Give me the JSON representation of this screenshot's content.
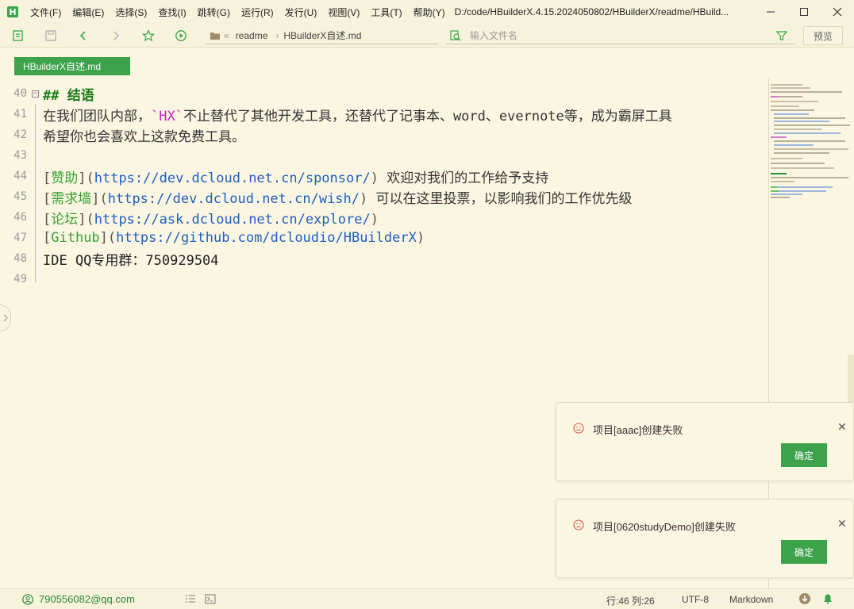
{
  "menubar": {
    "logo": "H",
    "items": [
      "文件(F)",
      "编辑(E)",
      "选择(S)",
      "查找(I)",
      "跳转(G)",
      "运行(R)",
      "发行(U)",
      "视图(V)",
      "工具(T)",
      "帮助(Y)"
    ],
    "path": "D:/code/HBuilderX.4.15.2024050802/HBuilderX/readme/HBuild..."
  },
  "toolbar": {
    "breadcrumb_sep": "«",
    "breadcrumb_folder": "readme",
    "breadcrumb_file": "HBuilderX自述.md",
    "search_placeholder": "输入文件名",
    "preview_label": "预览"
  },
  "tab": {
    "label": "HBuilderX自述.md"
  },
  "editor": {
    "lines": [
      {
        "num": "40"
      },
      {
        "num": "41"
      },
      {
        "num": "42"
      },
      {
        "num": "43"
      },
      {
        "num": "44"
      },
      {
        "num": "45"
      },
      {
        "num": "46"
      },
      {
        "num": "47"
      },
      {
        "num": "48"
      },
      {
        "num": "49"
      }
    ],
    "l40": {
      "hash": "## ",
      "text": "结语"
    },
    "l41": {
      "pre": "在我们团队内部，",
      "code": "`HX`",
      "post": "不止替代了其他开发工具，还替代了记事本、word、evernote等，成为霸屏工具"
    },
    "l42": {
      "text": "希望你也会喜欢上这款免费工具。"
    },
    "l44": {
      "label": "赞助",
      "url": "https://dev.dcloud.net.cn/sponsor/",
      "desc": " 欢迎对我们的工作给予支持"
    },
    "l45": {
      "label": "需求墙",
      "url": "https://dev.dcloud.net.cn/wish/",
      "desc": " 可以在这里投票，以影响我们的工作优先级"
    },
    "l46": {
      "label": "论坛",
      "url": "https://ask.dcloud.net.cn/explore/",
      "desc": ""
    },
    "l47": {
      "label": "Github",
      "url": "https://github.com/dcloudio/HBuilderX",
      "desc": ""
    },
    "l48": {
      "text": "IDE QQ专用群：750929504"
    }
  },
  "notifications": [
    {
      "message": "项目[aaac]创建失败",
      "ok_label": "确定"
    },
    {
      "message": "项目[0620studyDemo]创建失败",
      "ok_label": "确定"
    }
  ],
  "statusbar": {
    "user": "790556082@qq.com",
    "position": "行:46  列:26",
    "encoding": "UTF-8",
    "language": "Markdown"
  },
  "colors": {
    "accent": "#3ca34a",
    "background": "#fbf6e1",
    "url": "#1f5fbf",
    "heading": "#1a7a1a",
    "inline_code": "#c22bc2"
  }
}
